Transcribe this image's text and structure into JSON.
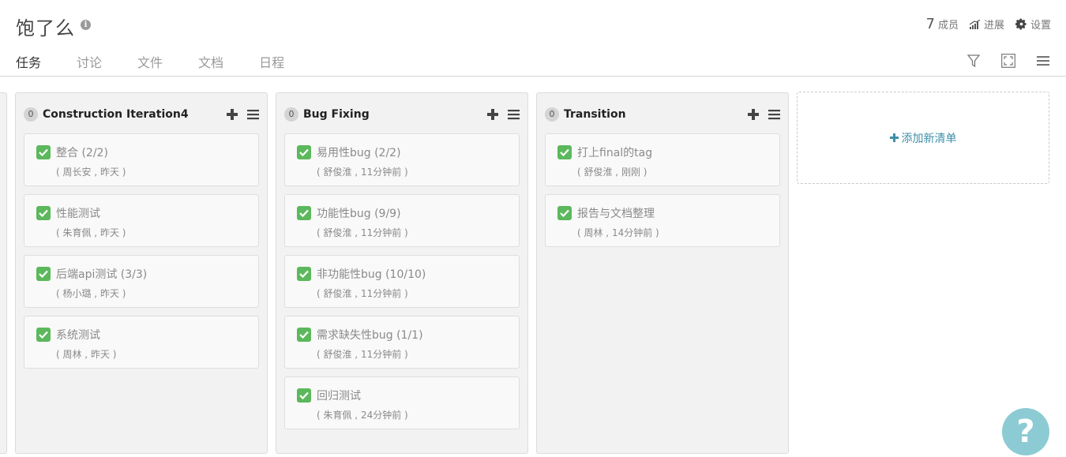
{
  "header": {
    "project_title": "饱了么",
    "member_count": "7",
    "members_label": "成员",
    "progress_label": "进展",
    "settings_label": "设置"
  },
  "tabs": [
    {
      "label": "任务",
      "active": true
    },
    {
      "label": "讨论",
      "active": false
    },
    {
      "label": "文件",
      "active": false
    },
    {
      "label": "文档",
      "active": false
    },
    {
      "label": "日程",
      "active": false
    }
  ],
  "columns": [
    {
      "count": "0",
      "title": "Construction Iteration4",
      "cards": [
        {
          "title": "整合 (2/2)",
          "meta": "( 周长安 , 昨天 )"
        },
        {
          "title": "性能测试",
          "meta": "( 朱育佩 , 昨天 )"
        },
        {
          "title": "后端api测试 (3/3)",
          "meta": "( 杨小璐 , 昨天 )"
        },
        {
          "title": "系统测试",
          "meta": "( 周林 , 昨天 )"
        }
      ]
    },
    {
      "count": "0",
      "title": "Bug Fixing",
      "cards": [
        {
          "title": "易用性bug (2/2)",
          "meta": "( 舒俊淮 , 11分钟前 )"
        },
        {
          "title": "功能性bug (9/9)",
          "meta": "( 舒俊淮 , 11分钟前 )"
        },
        {
          "title": "非功能性bug (10/10)",
          "meta": "( 舒俊淮 , 11分钟前 )"
        },
        {
          "title": "需求缺失性bug (1/1)",
          "meta": "( 舒俊淮 , 11分钟前 )"
        },
        {
          "title": "回归测试",
          "meta": "( 朱育佩 , 24分钟前 )"
        }
      ]
    },
    {
      "count": "0",
      "title": "Transition",
      "cards": [
        {
          "title": "打上final的tag",
          "meta": "( 舒俊淮 , 刚刚 )"
        },
        {
          "title": "报告与文档整理",
          "meta": "( 周林 , 14分钟前 )"
        }
      ]
    }
  ],
  "add_list_label": "添加新清单",
  "help_label": "?",
  "colors": {
    "check_green": "#5cb85c",
    "link_teal": "#3d8fa8",
    "help_bg": "#8ccbd3"
  }
}
